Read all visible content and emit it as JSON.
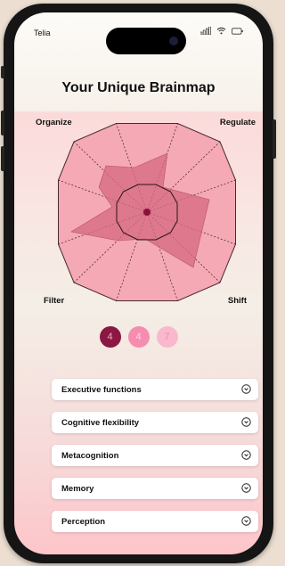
{
  "status_bar": {
    "carrier": "Telia"
  },
  "screen": {
    "title": "Your Unique Brainmap",
    "radar": {
      "axes": [
        "Organize",
        "Regulate",
        "Shift",
        "Filter"
      ],
      "fill_color": "#d66a82",
      "outer_color": "#f4a9b4",
      "center_color": "#8b0f3a"
    },
    "pager": [
      {
        "label": "4",
        "state": "active"
      },
      {
        "label": "4",
        "state": "inactive"
      },
      {
        "label": "7",
        "state": "inactive"
      }
    ],
    "sections": [
      {
        "label": "Executive functions",
        "icon": "chevron-down-icon"
      },
      {
        "label": "Cognitive flexibility",
        "icon": "chevron-down-icon"
      },
      {
        "label": "Metacognition",
        "icon": "chevron-down-icon"
      },
      {
        "label": "Memory",
        "icon": "chevron-down-icon"
      },
      {
        "label": "Perception",
        "icon": "chevron-down-icon"
      }
    ]
  }
}
